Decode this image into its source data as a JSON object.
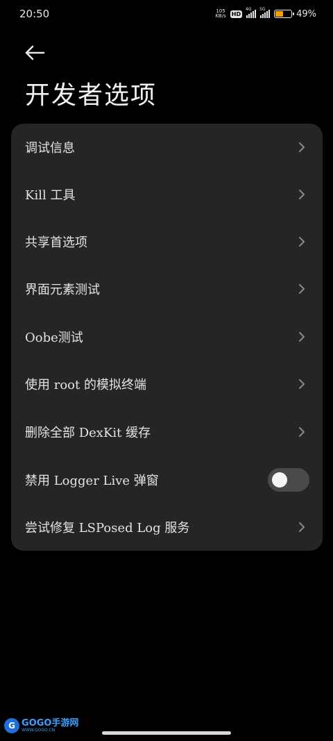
{
  "status_bar": {
    "time": "20:50",
    "net_speed_value": "105",
    "net_speed_unit": "KB/s",
    "hd_label": "HD",
    "sim1_label": "4G",
    "sim2_label": "5G",
    "battery_percent": "49",
    "battery_level": 0.49,
    "battery_color": "#f0a000"
  },
  "header": {
    "back_icon": "arrow-left-icon",
    "title": "开发者选项"
  },
  "menu": {
    "items": [
      {
        "label": "调试信息",
        "control": "chevron"
      },
      {
        "label": "Kill 工具",
        "control": "chevron"
      },
      {
        "label": "共享首选项",
        "control": "chevron"
      },
      {
        "label": "界面元素测试",
        "control": "chevron"
      },
      {
        "label": "Oobe测试",
        "control": "chevron"
      },
      {
        "label": "使用 root 的模拟终端",
        "control": "chevron"
      },
      {
        "label": "删除全部 DexKit 缓存",
        "control": "chevron"
      },
      {
        "label": "禁用 Logger Live 弹窗",
        "control": "toggle",
        "toggle_on": false
      },
      {
        "label": "尝试修复 LSPosed Log 服务",
        "control": "chevron"
      }
    ]
  },
  "watermark": {
    "brand": "GOGO手游网",
    "url": "WWW.GOGO.CN"
  },
  "colors": {
    "background": "#000000",
    "card": "#252525",
    "toggle_track": "#4a4a4a"
  }
}
